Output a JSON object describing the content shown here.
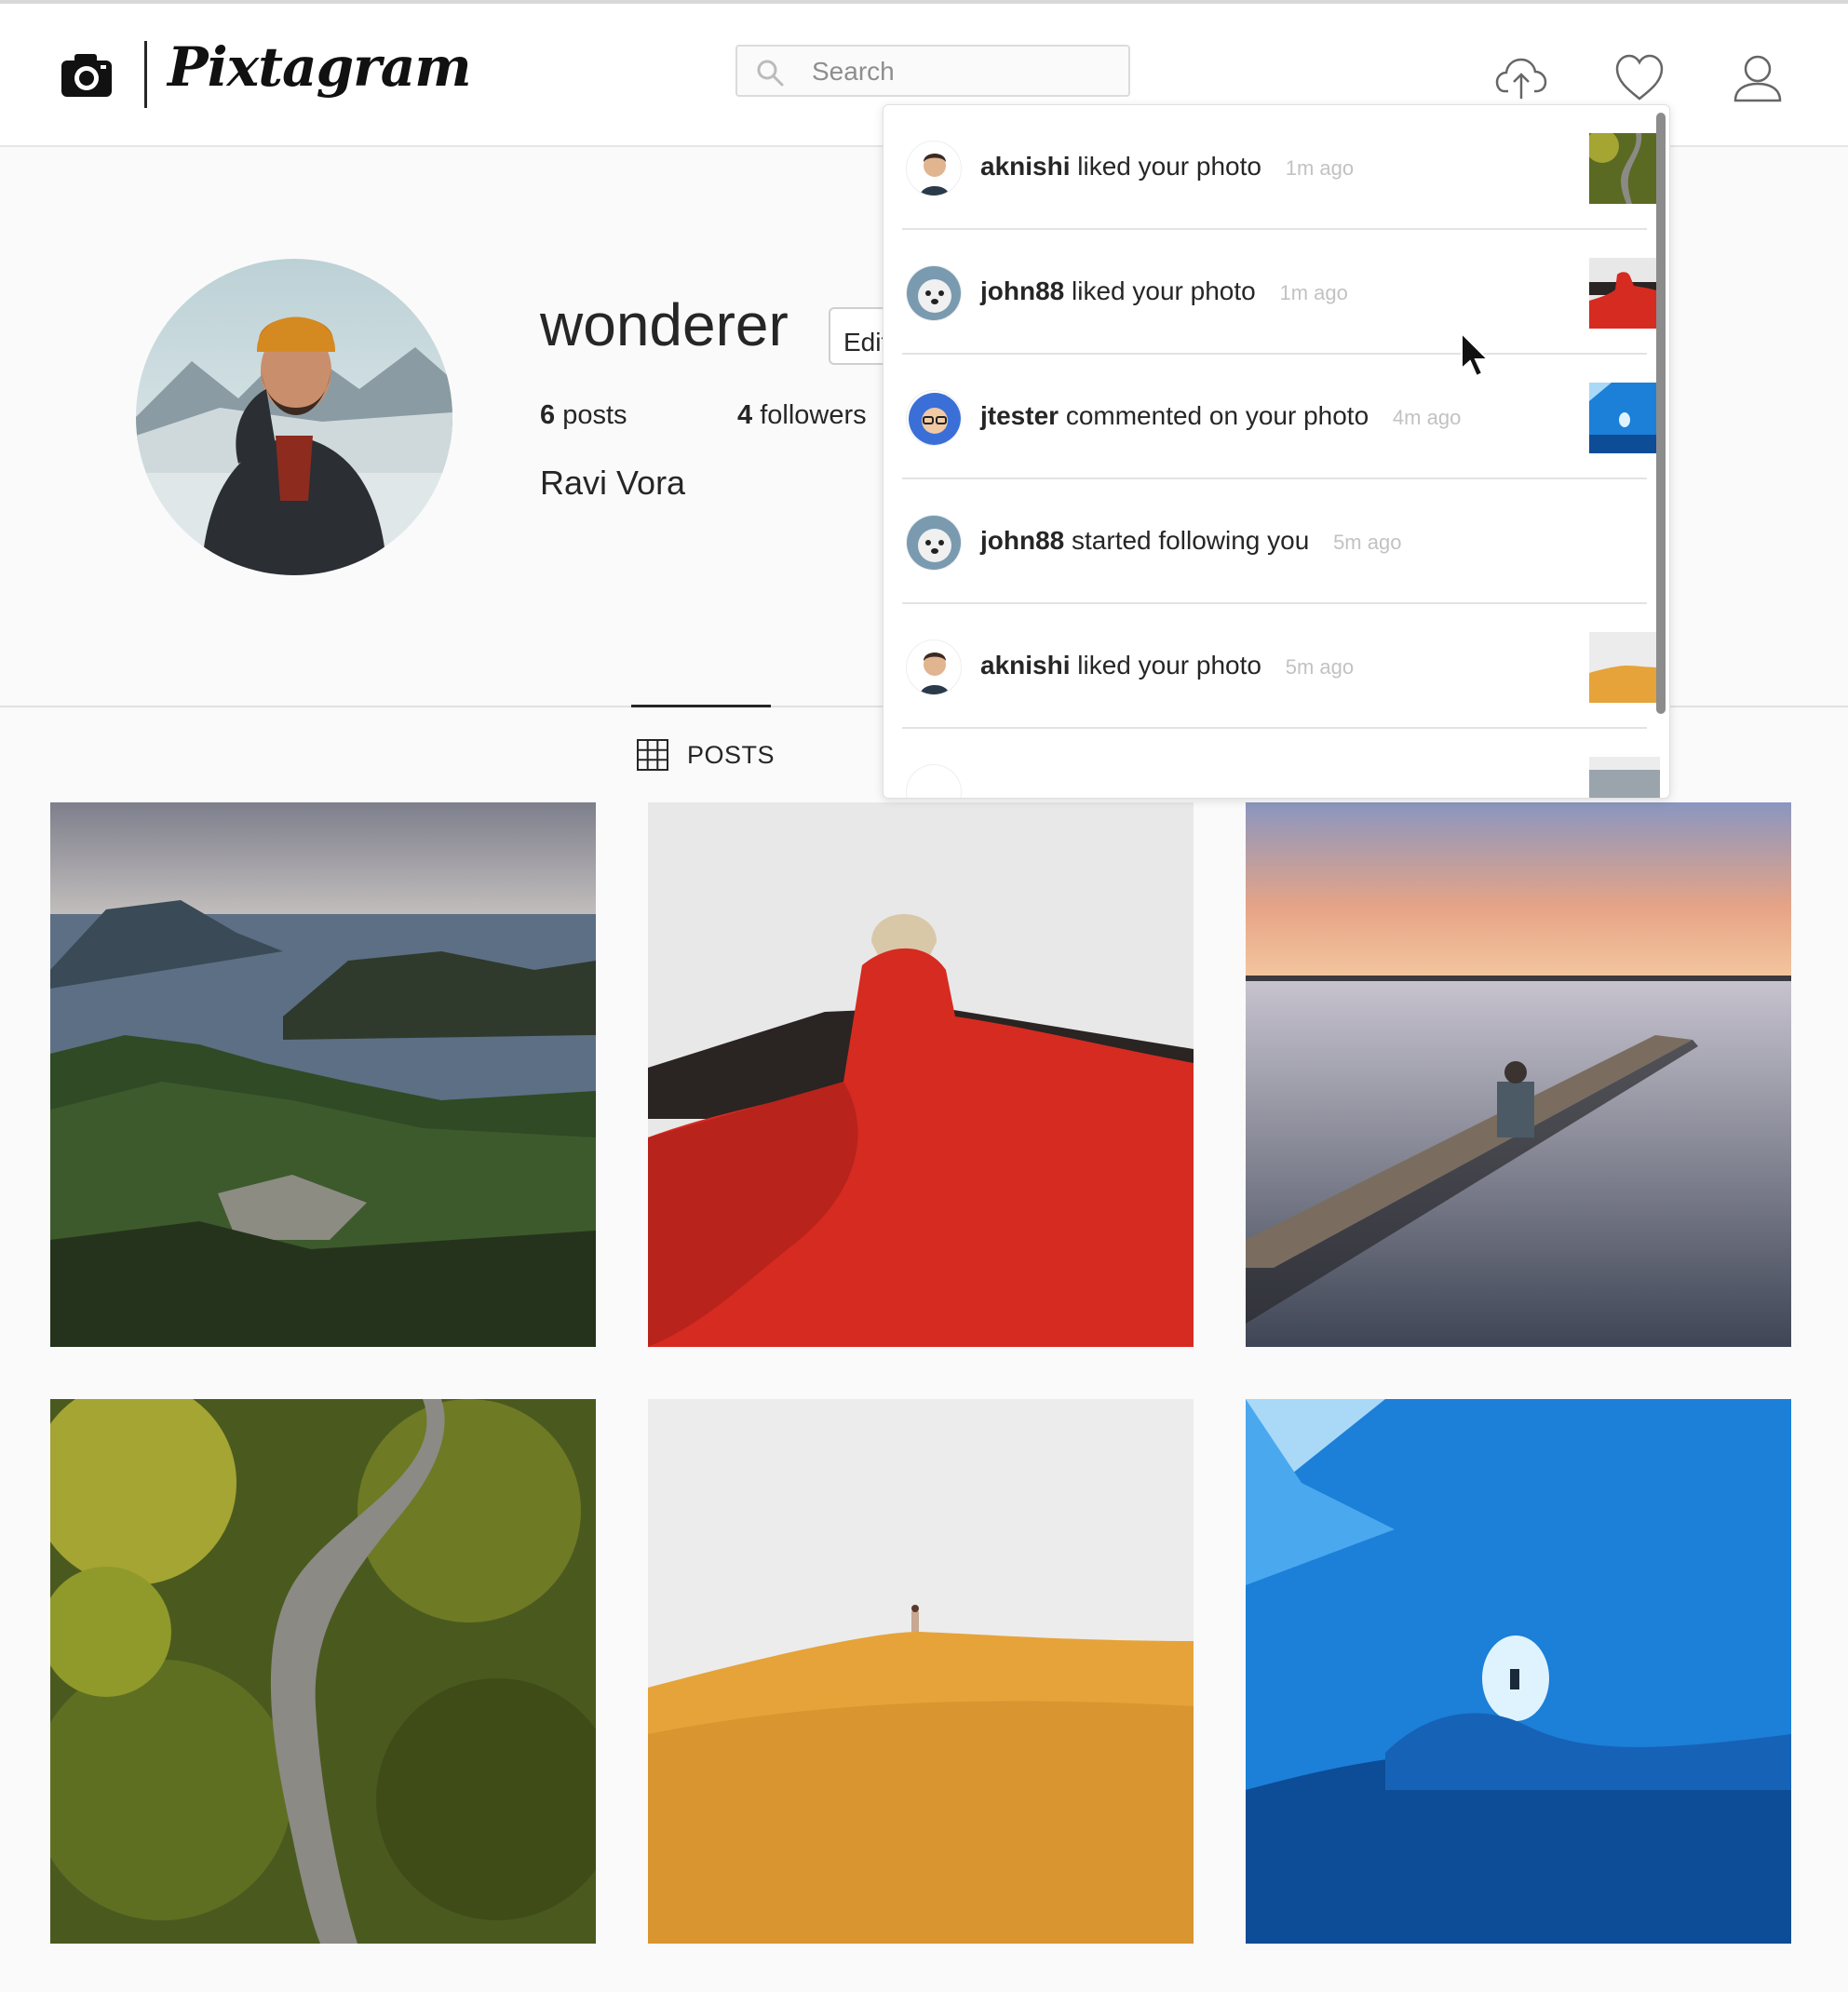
{
  "app": {
    "logo_text": "Pixtagram",
    "icons": {
      "logo": "camera-icon",
      "upload": "cloud-upload-icon",
      "activity": "heart-icon",
      "profile": "user-icon"
    }
  },
  "search": {
    "placeholder": "Search"
  },
  "profile": {
    "username": "wonderer",
    "edit_label": "Edit",
    "posts_count": "6",
    "posts_label": "posts",
    "followers_count": "4",
    "followers_label": "followers",
    "full_name": "Ravi Vora"
  },
  "tabs": [
    {
      "label": "POSTS",
      "icon": "grid-icon",
      "active": true
    }
  ],
  "notifications": [
    {
      "user": "aknishi",
      "action": "liked your photo",
      "time": "1m ago",
      "avatar": "aknishi-avatar",
      "thumbnail": "forest-road"
    },
    {
      "user": "john88",
      "action": "liked your photo",
      "time": "1m ago",
      "avatar": "john88-avatar",
      "thumbnail": "red-cloth"
    },
    {
      "user": "jtester",
      "action": "commented on your photo",
      "time": "4m ago",
      "avatar": "jtester-avatar",
      "thumbnail": "ice-cave"
    },
    {
      "user": "john88",
      "action": "started following you",
      "time": "5m ago",
      "avatar": "john88-avatar",
      "thumbnail": null
    },
    {
      "user": "aknishi",
      "action": "liked your photo",
      "time": "5m ago",
      "avatar": "aknishi-avatar",
      "thumbnail": "desert-dune"
    }
  ],
  "posts": [
    "lake-fjord",
    "red-cloth",
    "sunset-pier",
    "forest-road",
    "desert-dune",
    "ice-cave"
  ],
  "colors": {
    "accent_text": "#262626",
    "muted_text": "#c2c2c2",
    "border": "#dbdbdb",
    "background": "#fafafa"
  }
}
